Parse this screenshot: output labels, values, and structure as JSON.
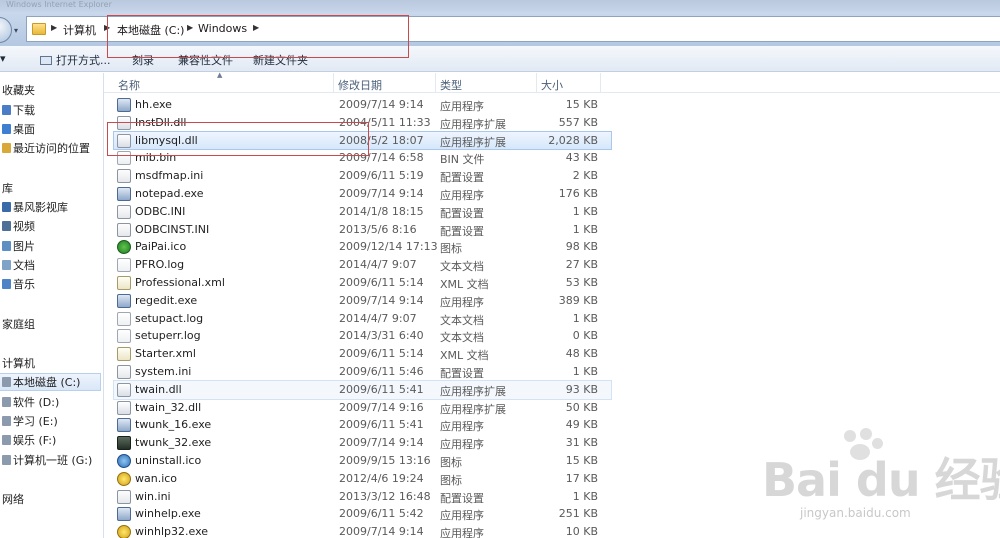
{
  "window": {
    "title": "Windows Internet Explorer"
  },
  "address": {
    "crumbs": [
      "计算机",
      "本地磁盘 (C:)",
      "Windows"
    ]
  },
  "toolbar": {
    "organize": "",
    "open_with": "打开方式...",
    "burn": "刻录",
    "compat_files": "兼容性文件",
    "new_folder": "新建文件夹"
  },
  "nav": {
    "favorites": "收藏夹",
    "downloads": "下载",
    "desktop": "桌面",
    "recent": "最近访问的位置",
    "libraries": "库",
    "storm": "暴风影视库",
    "videos": "视频",
    "pictures": "图片",
    "documents": "文档",
    "music": "音乐",
    "homegroup": "家庭组",
    "computer": "计算机",
    "drive_c": "本地磁盘 (C:)",
    "drive_d": "软件 (D:)",
    "drive_e": "学习 (E:)",
    "drive_f": "娱乐 (F:)",
    "drive_g": "计算机一班 (G:)",
    "network": "网络"
  },
  "columns": {
    "name": "名称",
    "date": "修改日期",
    "type": "类型",
    "size": "大小"
  },
  "files": [
    {
      "name": "hh.exe",
      "date": "2009/7/14 9:14",
      "type": "应用程序",
      "size": "15 KB",
      "icon": "exe-icon"
    },
    {
      "name": "InstDll.dll",
      "date": "2004/5/11 11:33",
      "type": "应用程序扩展",
      "size": "557 KB",
      "icon": "dll-icon"
    },
    {
      "name": "libmysql.dll",
      "date": "2008/5/2 18:07",
      "type": "应用程序扩展",
      "size": "2,028 KB",
      "icon": "dll-icon"
    },
    {
      "name": "mib.bin",
      "date": "2009/7/14 6:58",
      "type": "BIN 文件",
      "size": "43 KB",
      "icon": "bin-icon"
    },
    {
      "name": "msdfmap.ini",
      "date": "2009/6/11 5:19",
      "type": "配置设置",
      "size": "2 KB",
      "icon": "ini-icon"
    },
    {
      "name": "notepad.exe",
      "date": "2009/7/14 9:14",
      "type": "应用程序",
      "size": "176 KB",
      "icon": "exe-icon"
    },
    {
      "name": "ODBC.INI",
      "date": "2014/1/8 18:15",
      "type": "配置设置",
      "size": "1 KB",
      "icon": "ini-icon"
    },
    {
      "name": "ODBCINST.INI",
      "date": "2013/5/6 8:16",
      "type": "配置设置",
      "size": "1 KB",
      "icon": "ini-icon"
    },
    {
      "name": "PaiPai.ico",
      "date": "2009/12/14 17:13",
      "type": "图标",
      "size": "98 KB",
      "icon": "paipai-icon"
    },
    {
      "name": "PFRO.log",
      "date": "2014/4/7 9:07",
      "type": "文本文档",
      "size": "27 KB",
      "icon": "log-icon"
    },
    {
      "name": "Professional.xml",
      "date": "2009/6/11 5:14",
      "type": "XML 文档",
      "size": "53 KB",
      "icon": "xml-icon"
    },
    {
      "name": "regedit.exe",
      "date": "2009/7/14 9:14",
      "type": "应用程序",
      "size": "389 KB",
      "icon": "regedit-icon"
    },
    {
      "name": "setupact.log",
      "date": "2014/4/7 9:07",
      "type": "文本文档",
      "size": "1 KB",
      "icon": "log-icon"
    },
    {
      "name": "setuperr.log",
      "date": "2014/3/31 6:40",
      "type": "文本文档",
      "size": "0 KB",
      "icon": "log-icon"
    },
    {
      "name": "Starter.xml",
      "date": "2009/6/11 5:14",
      "type": "XML 文档",
      "size": "48 KB",
      "icon": "xml-icon"
    },
    {
      "name": "system.ini",
      "date": "2009/6/11 5:46",
      "type": "配置设置",
      "size": "1 KB",
      "icon": "ini-icon"
    },
    {
      "name": "twain.dll",
      "date": "2009/6/11 5:41",
      "type": "应用程序扩展",
      "size": "93 KB",
      "icon": "dll-icon"
    },
    {
      "name": "twain_32.dll",
      "date": "2009/7/14 9:16",
      "type": "应用程序扩展",
      "size": "50 KB",
      "icon": "dll-icon"
    },
    {
      "name": "twunk_16.exe",
      "date": "2009/6/11 5:41",
      "type": "应用程序",
      "size": "49 KB",
      "icon": "exe-icon"
    },
    {
      "name": "twunk_32.exe",
      "date": "2009/7/14 9:14",
      "type": "应用程序",
      "size": "31 KB",
      "icon": "twunk-icon"
    },
    {
      "name": "uninstall.ico",
      "date": "2009/9/15 13:16",
      "type": "图标",
      "size": "15 KB",
      "icon": "uninstall-icon"
    },
    {
      "name": "wan.ico",
      "date": "2012/4/6 19:24",
      "type": "图标",
      "size": "17 KB",
      "icon": "wan-icon"
    },
    {
      "name": "win.ini",
      "date": "2013/3/12 16:48",
      "type": "配置设置",
      "size": "1 KB",
      "icon": "ini-icon"
    },
    {
      "name": "winhelp.exe",
      "date": "2009/6/11 5:42",
      "type": "应用程序",
      "size": "251 KB",
      "icon": "exe-icon"
    },
    {
      "name": "winhlp32.exe",
      "date": "2009/7/14 9:14",
      "type": "应用程序",
      "size": "10 KB",
      "icon": "help-icon"
    }
  ],
  "watermark": {
    "brand": "Bai du 经验",
    "url": "jingyan.baidu.com"
  }
}
